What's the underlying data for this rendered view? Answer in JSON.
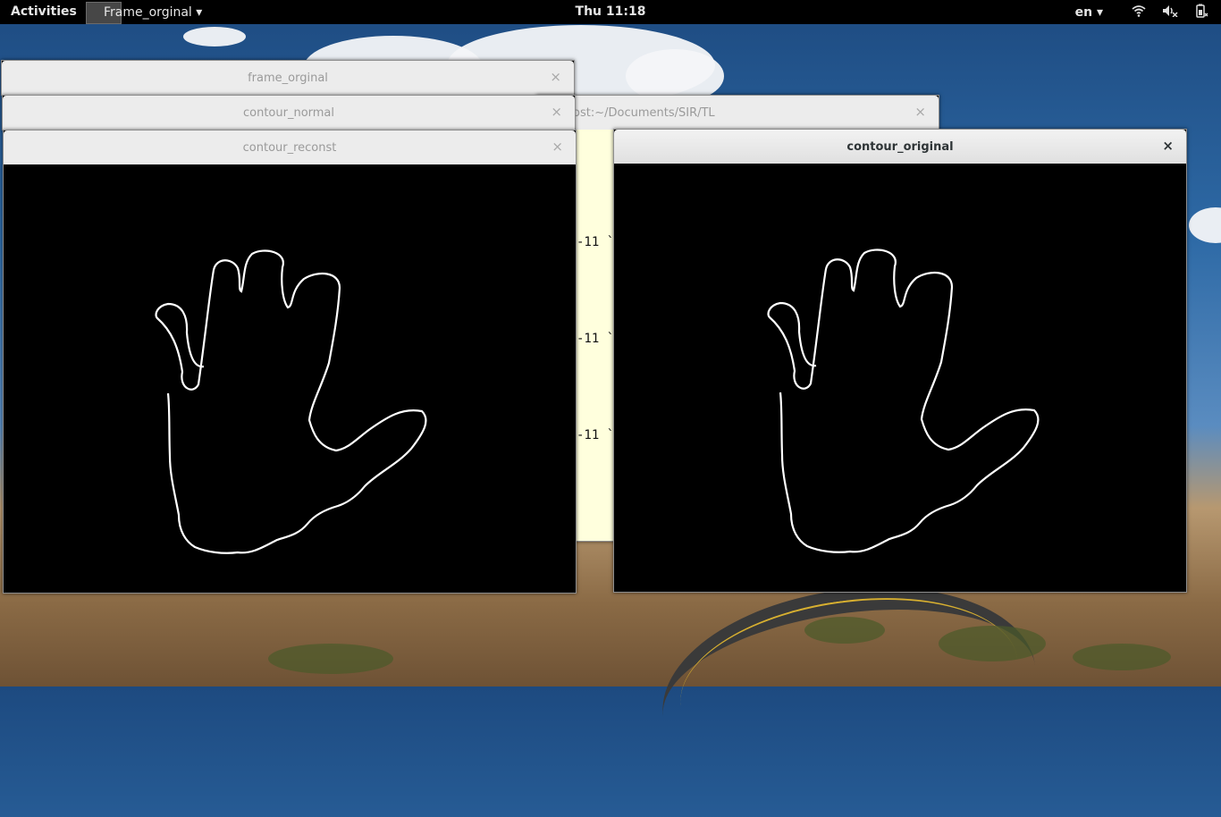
{
  "topbar": {
    "activities": "Activities",
    "app_menu": "Frame_orginal ▾",
    "clock": "Thu 11:18",
    "language": "en ▾",
    "icons": [
      "wifi-icon",
      "volume-muted-icon",
      "battery-icon"
    ]
  },
  "windows": {
    "frame_orginal": {
      "title": "frame_orginal",
      "close": "×"
    },
    "contour_normal": {
      "title": "contour_normal",
      "close": "×"
    },
    "terminal": {
      "title": "ost:~/Documents/SIR/TL",
      "close": "×",
      "lines": [
        "-11  `",
        "-11  `",
        "-11  `"
      ]
    },
    "contour_reconst": {
      "title": "contour_reconst",
      "close": "×"
    },
    "contour_original": {
      "title": "contour_original",
      "close": "×"
    }
  },
  "colors": {
    "topbar_bg": "#000000",
    "titlebar_bg": "#ececec",
    "terminal_bg": "#ffffdd",
    "contour_stroke": "#ffffff"
  }
}
